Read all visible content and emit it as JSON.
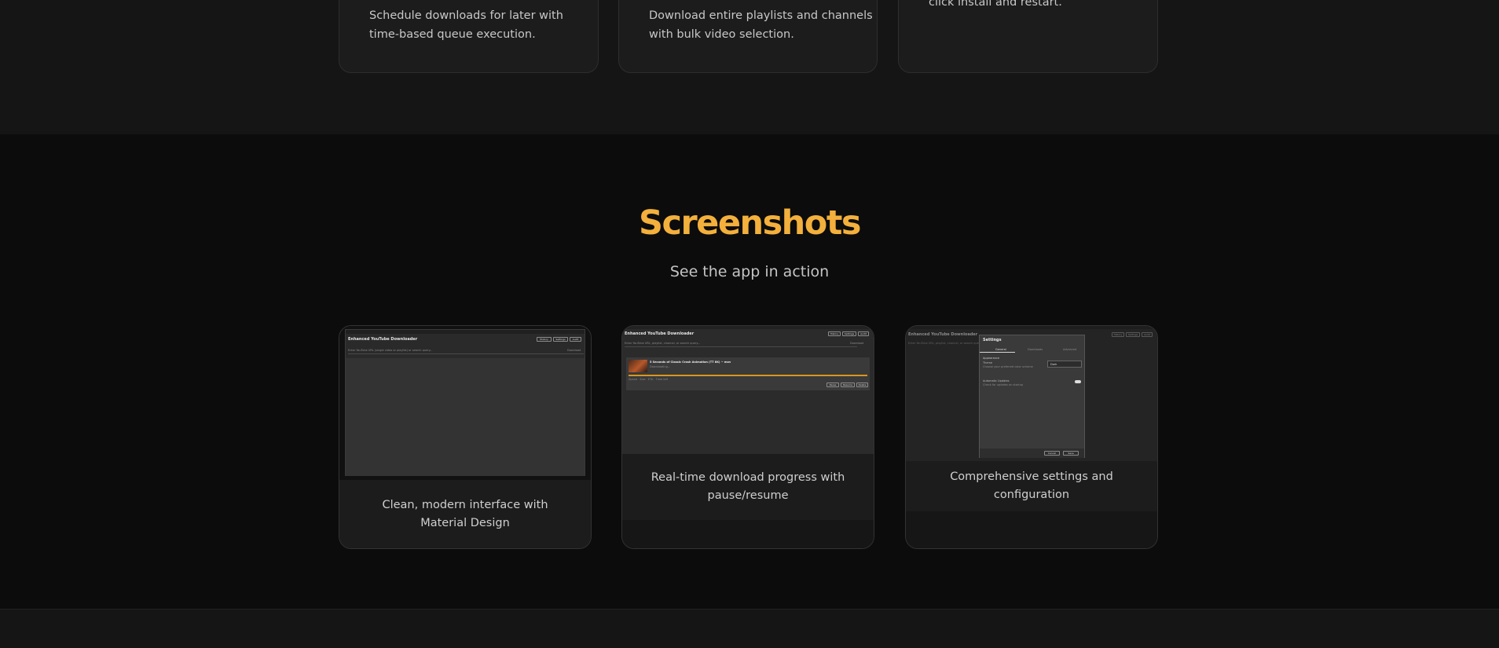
{
  "features": [
    {
      "line1": "Schedule downloads for later with",
      "line2": "time-based queue execution."
    },
    {
      "line1": "Download entire playlists and channels",
      "line2": "with bulk video selection."
    },
    {
      "line1": "click install and restart.",
      "line2": ""
    }
  ],
  "screenshots_section": {
    "title": "Screenshots",
    "subtitle": "See the app in action"
  },
  "screenshots": [
    {
      "caption": "Clean, modern interface with Material Design"
    },
    {
      "caption": "Real-time download progress with pause/resume"
    },
    {
      "caption": "Comprehensive settings and configuration"
    }
  ],
  "mock_app": {
    "window_title": "Enhanced YouTube Downloader",
    "btn_history": "History",
    "btn_settings": "Settings",
    "btn_audit": "Audit",
    "url_placeholder": "Enter YouTube URL (single video or playlist) or search query...",
    "url_placeholder_short": "Enter YouTube URL, playlist, channel, or search query...",
    "download_label": "Download",
    "video_title": "5 Seconds of Classic Crash Animation (TT 8K) ~ mov",
    "video_status": "Downloading...",
    "video_meta": "Speed · Size · ETA · Time left",
    "btn_pause": "Pause",
    "btn_resume": "Resume",
    "btn_delete": "Delete",
    "settings_title": "Settings",
    "tab_general": "General",
    "tab_downloads": "Downloads",
    "tab_advanced": "Advanced",
    "appearance_label": "Appearance",
    "theme_label": "Theme",
    "theme_hint": "Choose your preferred color scheme",
    "theme_value": "Dark",
    "updates_label": "Automatic Updates",
    "updates_hint": "Check for updates on startup",
    "btn_cancel": "Cancel",
    "btn_save": "Save"
  },
  "colors": {
    "accent": "#f3b03c",
    "progress": "#d9961f",
    "background": "#0c0c0c",
    "card": "#1c1c1c"
  }
}
